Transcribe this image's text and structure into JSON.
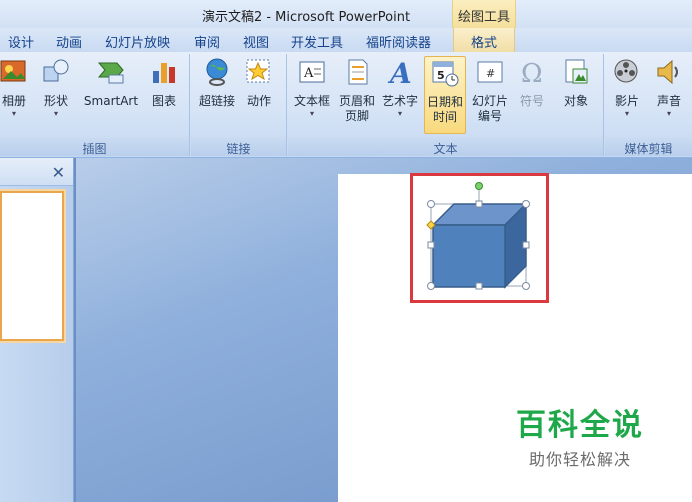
{
  "window": {
    "title": "演示文稿2 - Microsoft PowerPoint",
    "context_tab_group": "绘图工具"
  },
  "tabs": [
    "设计",
    "动画",
    "幻灯片放映",
    "审阅",
    "视图",
    "开发工具",
    "福昕阅读器"
  ],
  "context_tab": "格式",
  "ribbon": {
    "illustrations": {
      "label": "插图",
      "buttons": [
        "相册",
        "形状",
        "SmartArt",
        "图表"
      ]
    },
    "links": {
      "label": "链接",
      "buttons": [
        "超链接",
        "动作"
      ]
    },
    "text": {
      "label": "文本",
      "buttons": [
        "文本框",
        "页眉和",
        "页脚",
        "艺术字",
        "日期和",
        "时间",
        "幻灯片",
        "编号",
        "符号",
        "对象"
      ]
    },
    "media": {
      "label": "媒体剪辑",
      "buttons": [
        "影片",
        "声音"
      ]
    }
  },
  "watermark": {
    "line1": "百科全说",
    "line2": "助你轻松解决"
  },
  "colors": {
    "accent": "#15428b",
    "highlight_box": "#d9393f",
    "cube_face": "#4f81bd",
    "watermark_green": "#1ea84a"
  }
}
